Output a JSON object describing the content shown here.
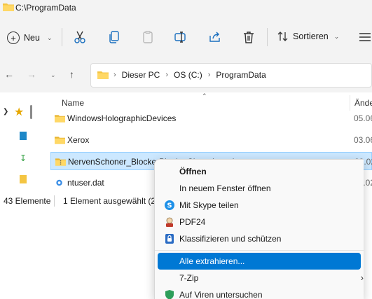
{
  "window": {
    "title": "C:\\ProgramData"
  },
  "toolbar": {
    "new_label": "Neu",
    "sort_label": "Sortieren",
    "icons": [
      "cut-icon",
      "copy-icon",
      "paste-icon",
      "rename-icon",
      "share-icon",
      "delete-icon"
    ]
  },
  "address": {
    "crumbs": [
      "Dieser PC",
      "OS (C:)",
      "ProgramData"
    ]
  },
  "columns": {
    "name": "Name",
    "date": "Ände"
  },
  "files": [
    {
      "name": "WindowsHolographicDevices",
      "date": "05.06",
      "type": "folder"
    },
    {
      "name": "Xerox",
      "date": "03.06",
      "type": "folder"
    },
    {
      "name": "NervenSchoner_BlockerPlugin_Chromium.zip",
      "date": "23.02",
      "type": "folder-zip",
      "selected": true
    },
    {
      "name": "ntuser.dat",
      "date": "17.02",
      "type": "file"
    }
  ],
  "status": {
    "count": "43 Elemente",
    "selection": "1 Element ausgewählt (2,"
  },
  "context_menu": {
    "items": [
      {
        "label": "Öffnen",
        "bold": true,
        "icon": ""
      },
      {
        "label": "In neuem Fenster öffnen",
        "icon": ""
      },
      {
        "label": "Mit Skype teilen",
        "icon": "skype-icon"
      },
      {
        "label": "PDF24",
        "icon": "pdf24-icon"
      },
      {
        "label": "Klassifizieren und schützen",
        "icon": "lock-icon"
      },
      {
        "label": "Alle extrahieren...",
        "icon": "",
        "highlighted": true
      },
      {
        "label": "7-Zip",
        "icon": "",
        "submenu": true
      },
      {
        "label": "Auf Viren untersuchen",
        "icon": "shield-icon"
      }
    ]
  },
  "colors": {
    "accent": "#0078d4",
    "selection": "#cce8ff",
    "folder": "#f4c542"
  }
}
